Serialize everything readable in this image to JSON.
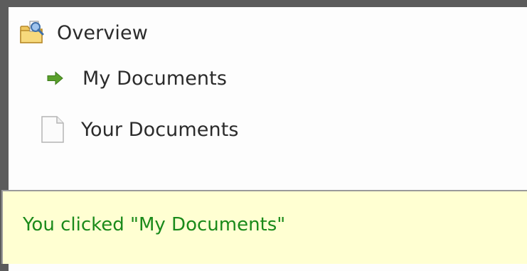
{
  "tree": {
    "items": [
      {
        "label": "Overview",
        "icon": "folder-search-icon"
      },
      {
        "label": "My Documents",
        "icon": "arrow-right-icon"
      },
      {
        "label": "Your Documents",
        "icon": "document-icon"
      }
    ]
  },
  "message": {
    "text": "You clicked \"My Documents\""
  },
  "colors": {
    "background": "#5c5c5c",
    "panel": "#fdfdfd",
    "message_bg": "#ffffd2",
    "message_text": "#1a8a1a",
    "arrow": "#5aa02c"
  }
}
